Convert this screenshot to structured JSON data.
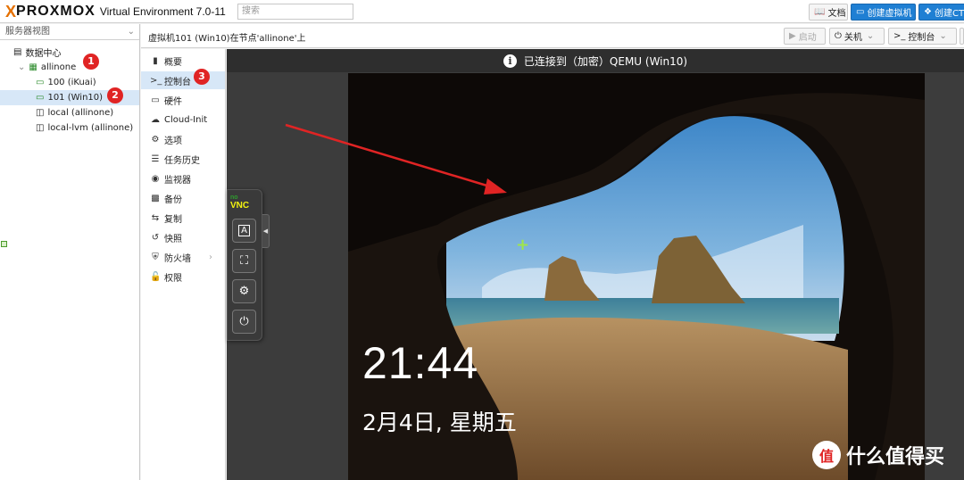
{
  "header": {
    "brand_x": "X",
    "brand_word": "PROXMOX",
    "product": "Virtual Environment 7.0-11",
    "search_placeholder": "搜索",
    "docs_label": "文档",
    "create_vm_label": "创建虚拟机",
    "create_ct_label": "创建CT"
  },
  "sidebar": {
    "view_selector": "服务器视图",
    "tree": [
      {
        "label": "数据中心"
      },
      {
        "label": "allinone"
      },
      {
        "label": "100 (iKuai)"
      },
      {
        "label": "101 (Win10)"
      },
      {
        "label": "local (allinone)"
      },
      {
        "label": "local-lvm (allinone)"
      }
    ]
  },
  "breadcrumb": "虚拟机101 (Win10)在节点'allinone'上",
  "actions": {
    "start": "启动",
    "shutdown": "关机",
    "console": "控制台"
  },
  "menu": [
    {
      "label": "概要",
      "icon": "book-icon"
    },
    {
      "label": "控制台",
      "icon": "terminal-icon"
    },
    {
      "label": "硬件",
      "icon": "monitor-icon"
    },
    {
      "label": "Cloud-Init",
      "icon": "cloud-icon"
    },
    {
      "label": "选项",
      "icon": "gear-icon"
    },
    {
      "label": "任务历史",
      "icon": "list-icon"
    },
    {
      "label": "监视器",
      "icon": "eye-icon"
    },
    {
      "label": "备份",
      "icon": "floppy-icon"
    },
    {
      "label": "复制",
      "icon": "retweet-icon"
    },
    {
      "label": "快照",
      "icon": "history-icon"
    },
    {
      "label": "防火墙",
      "icon": "shield-icon"
    },
    {
      "label": "权限",
      "icon": "unlock-icon"
    }
  ],
  "console": {
    "status": "已连接到（加密）QEMU (Win10)",
    "time": "21:44",
    "date": "2月4日, 星期五"
  },
  "vnc": {
    "logo_no": "no",
    "logo": "VNC"
  },
  "badges": [
    "1",
    "2",
    "3"
  ],
  "watermark": {
    "circle": "值",
    "text": "什么值得买"
  },
  "colors": {
    "accent_blue": "#1f7fd3",
    "badge_red": "#e02424",
    "selection": "#d7e7f7"
  }
}
